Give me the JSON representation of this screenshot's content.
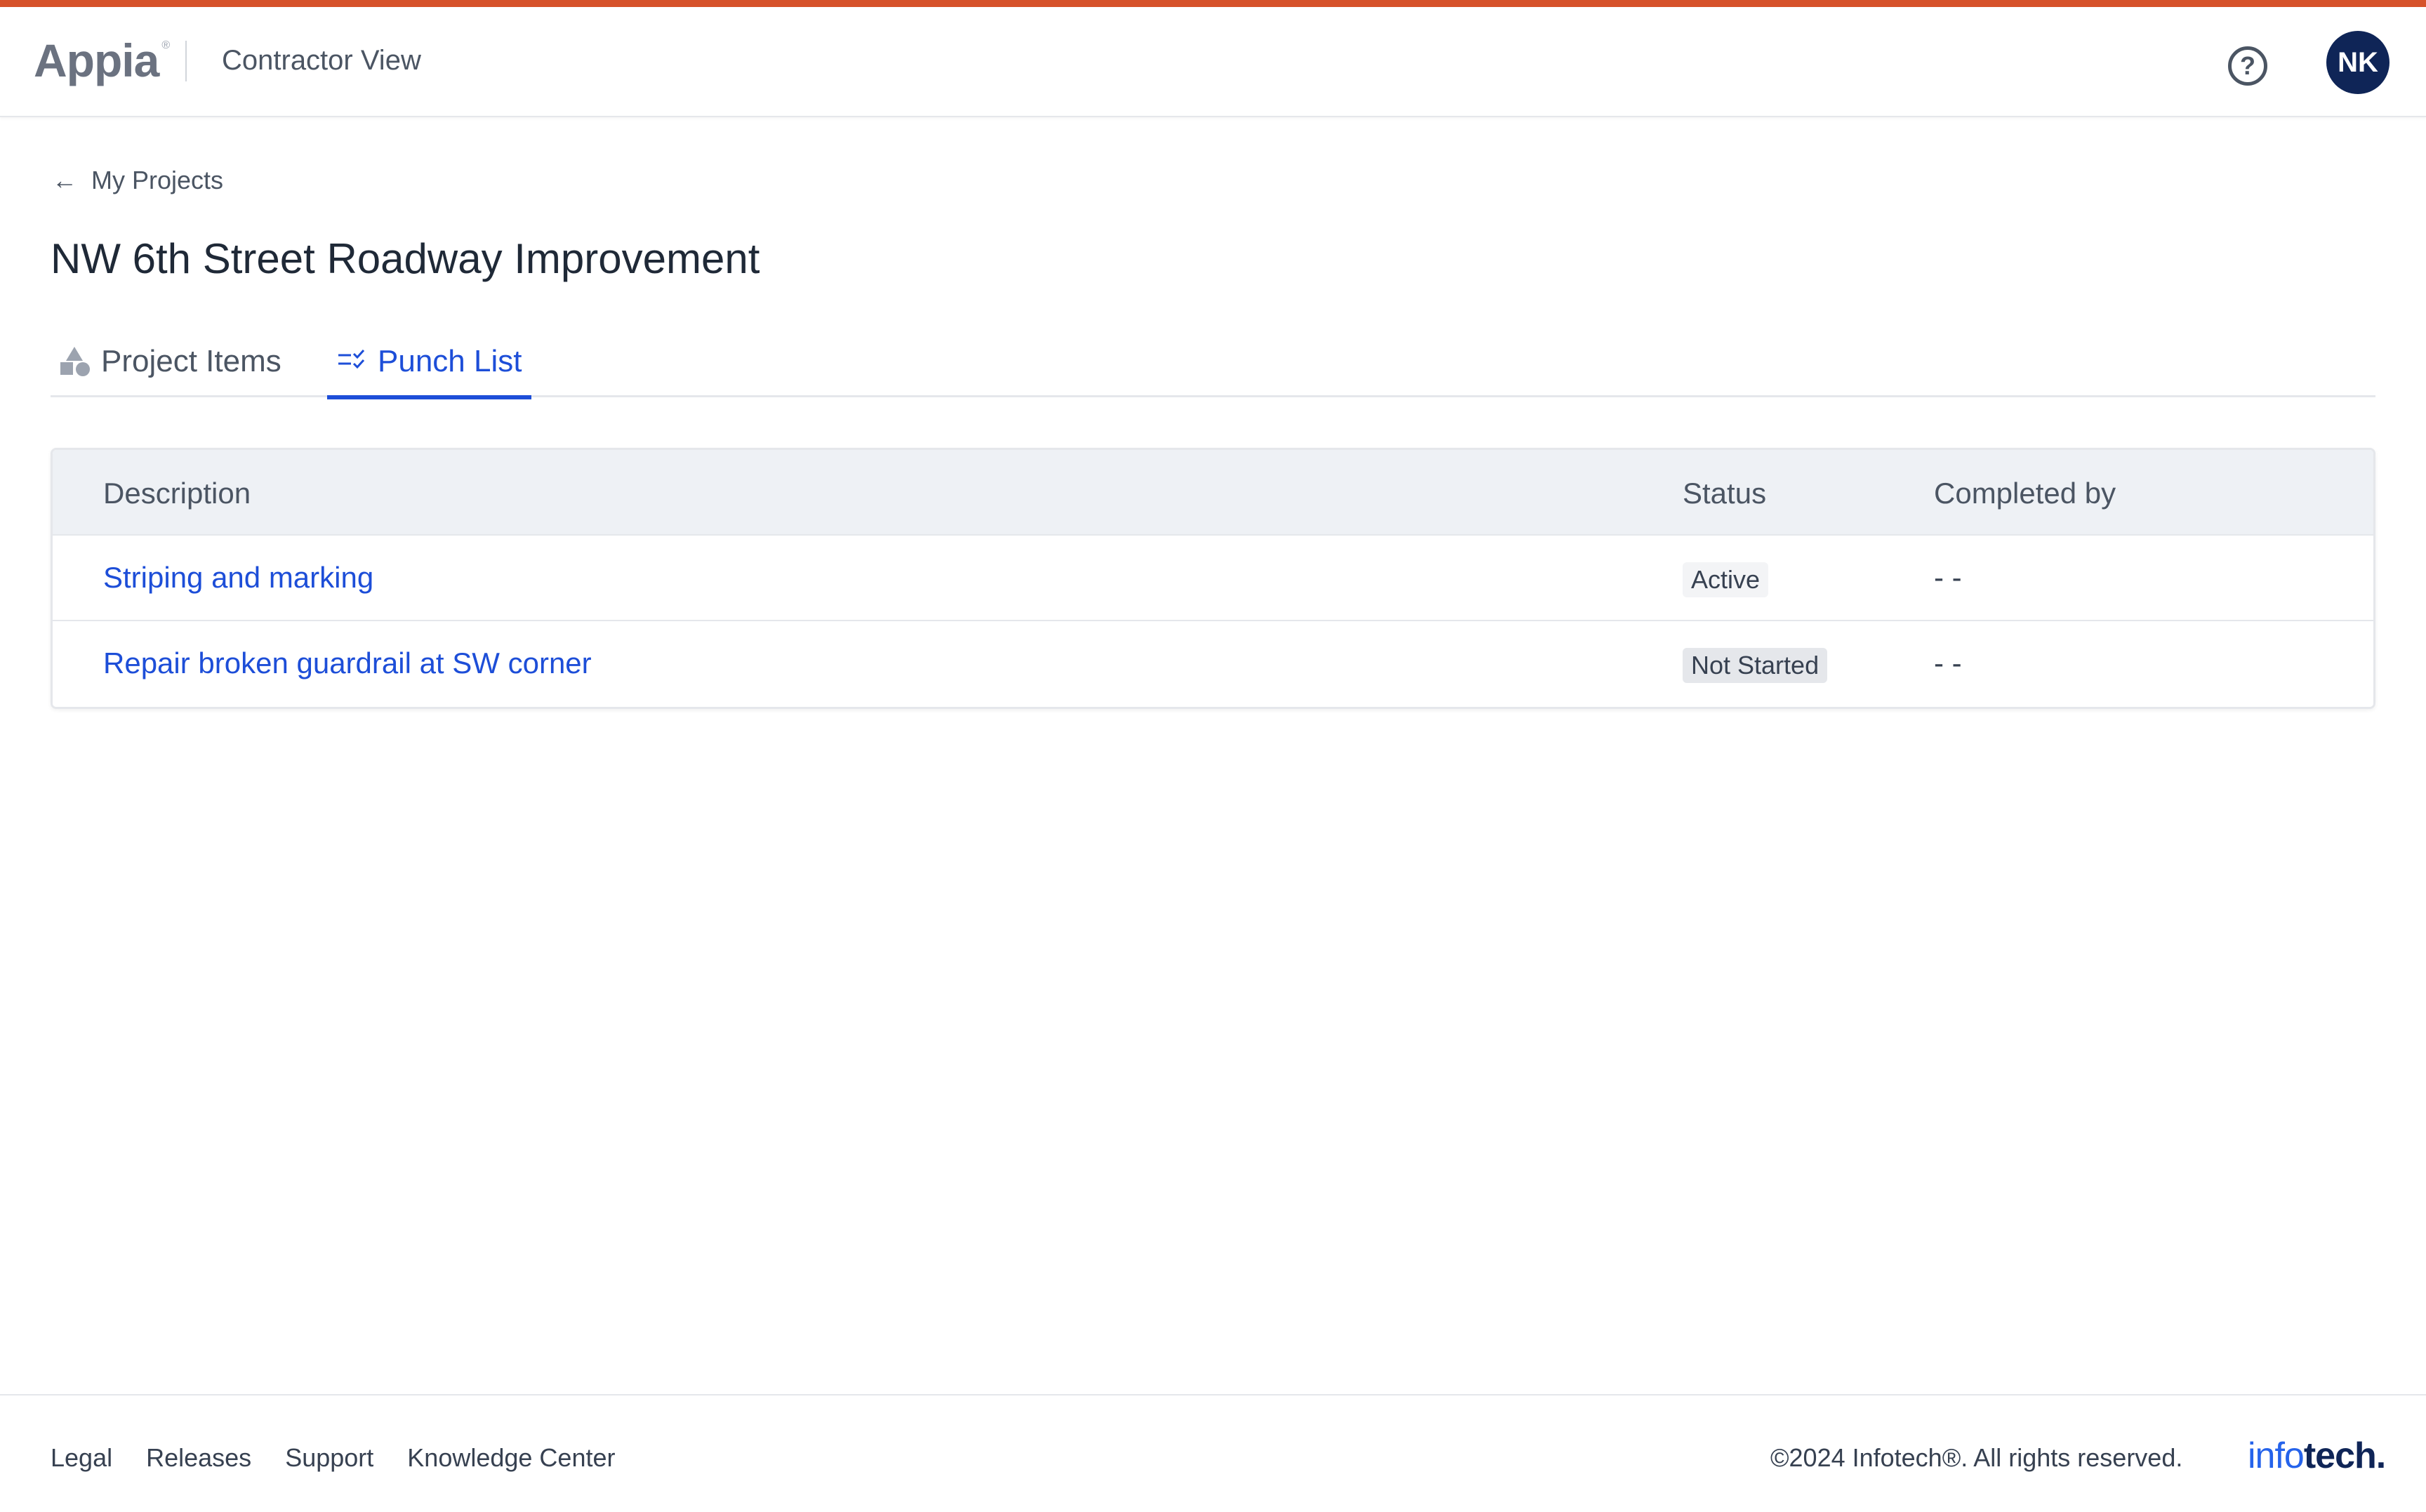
{
  "header": {
    "logo": "Appia",
    "logo_mark": "®",
    "view_title": "Contractor View",
    "help_icon": "?",
    "avatar_initials": "NK"
  },
  "breadcrumb": {
    "arrow": "←",
    "label": "My Projects"
  },
  "page_title": "NW 6th Street Roadway Improvement",
  "tabs": [
    {
      "label": "Project Items",
      "icon": "shapes-icon",
      "active": false
    },
    {
      "label": "Punch List",
      "icon": "checklist-icon",
      "active": true
    }
  ],
  "table": {
    "headers": [
      "Description",
      "Status",
      "Completed by"
    ],
    "rows": [
      {
        "description": "Striping and marking",
        "status": "Active",
        "completed_by": "- -"
      },
      {
        "description": "Repair broken guardrail at SW corner",
        "status": "Not Started",
        "completed_by": "- -"
      }
    ]
  },
  "footer": {
    "links": [
      "Legal",
      "Releases",
      "Support",
      "Knowledge Center"
    ],
    "copyright": "©2024 Infotech®. All rights reserved.",
    "brand_part1": "info",
    "brand_part2": "tech",
    "brand_dot": "."
  },
  "colors": {
    "accent": "#d6522a",
    "link": "#1d4ed8",
    "avatar_bg": "#0f2557"
  }
}
